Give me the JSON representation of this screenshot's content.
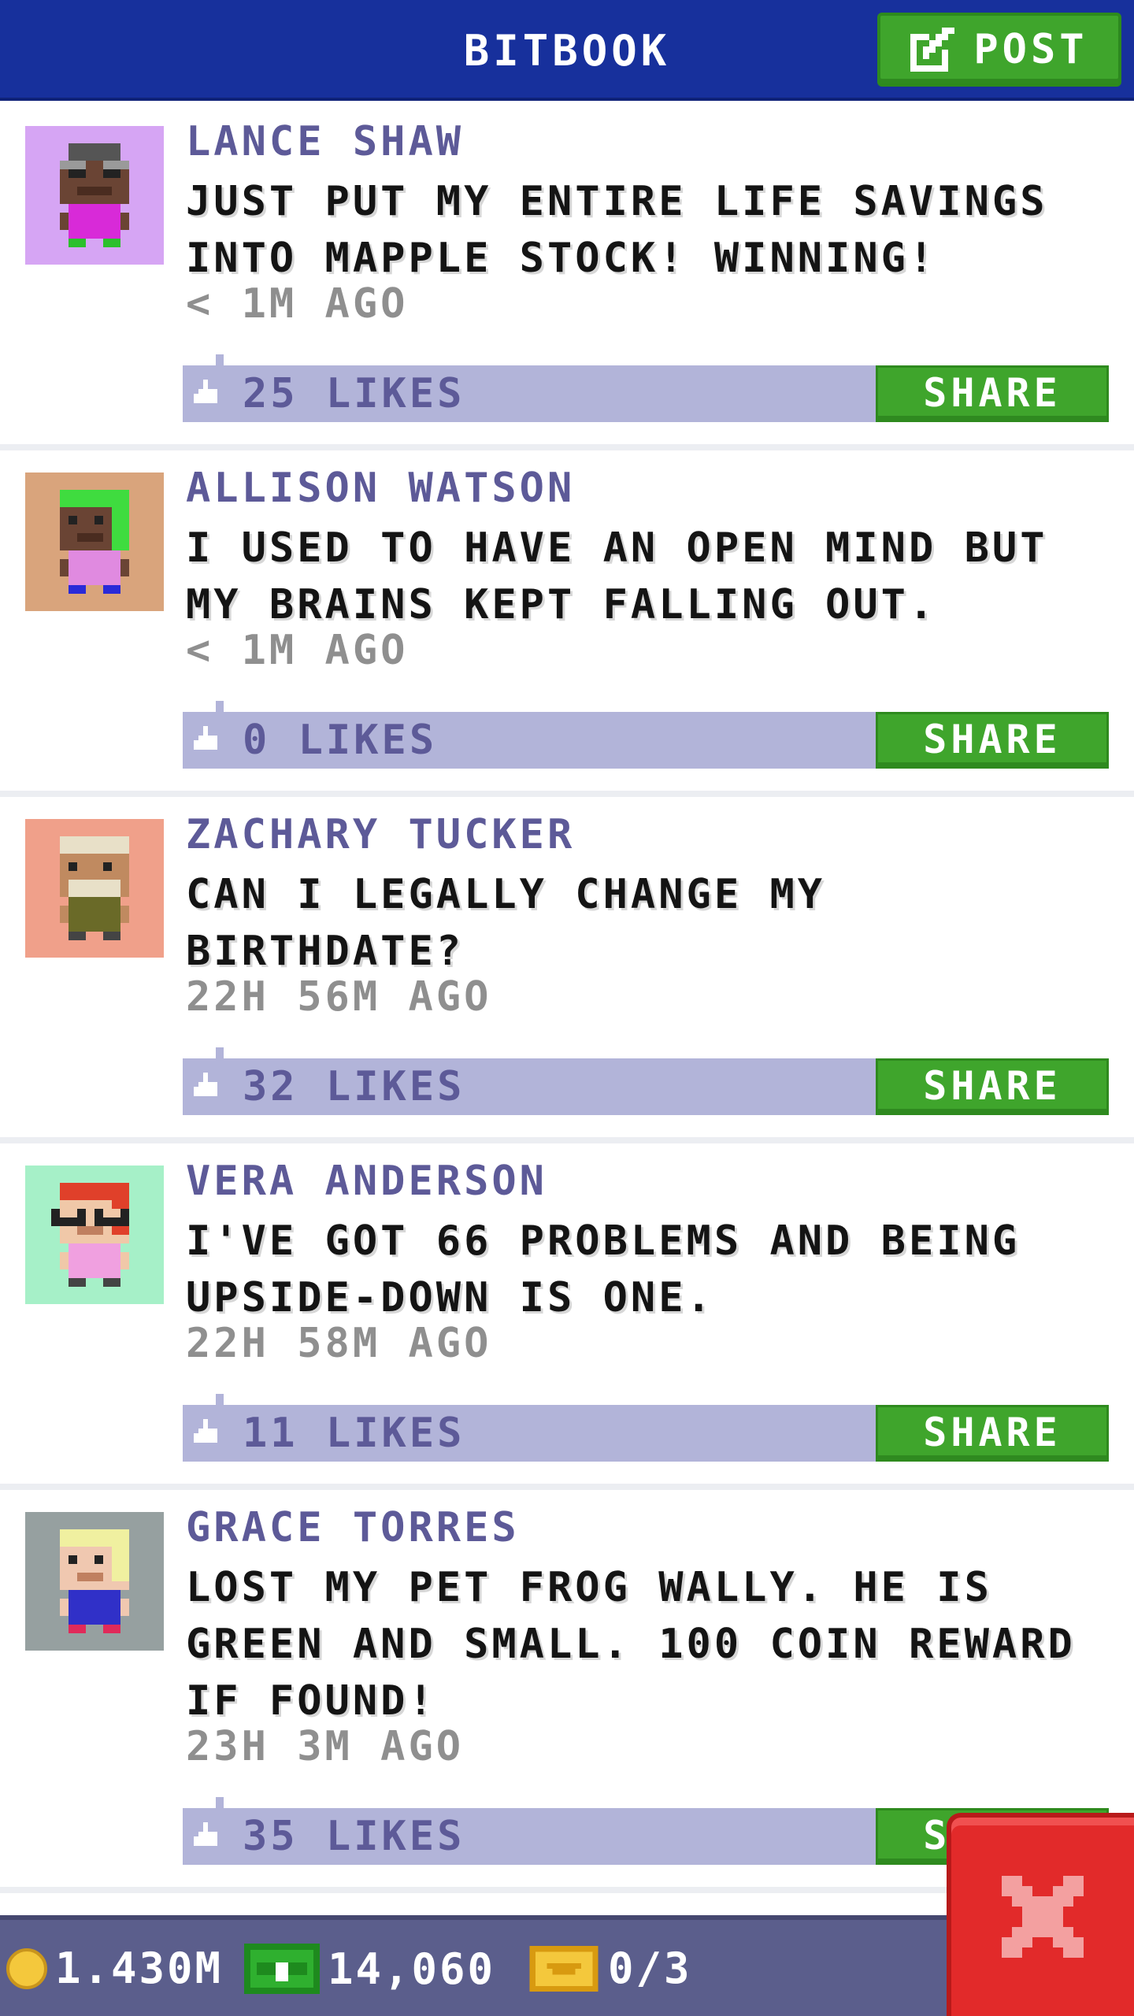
{
  "header": {
    "title": "BITBOOK",
    "post_label": "POST"
  },
  "posts": [
    {
      "name": "LANCE SHAW",
      "message": "JUST PUT MY ENTIRE LIFE SAVINGS INTO MAPPLE STOCK! WINNING!",
      "time": "< 1M AGO",
      "likes": "25 LIKES",
      "share_label": "SHARE",
      "avatar_bg": "#d6a5f4",
      "avatar_icon": "avatar-lance-shaw"
    },
    {
      "name": "ALLISON WATSON",
      "message": "I USED TO HAVE AN OPEN MIND BUT MY BRAINS KEPT FALLING OUT.",
      "time": "< 1M AGO",
      "likes": "0 LIKES",
      "share_label": "SHARE",
      "avatar_bg": "#d9a47c",
      "avatar_icon": "avatar-allison-watson"
    },
    {
      "name": "ZACHARY TUCKER",
      "message": "CAN I LEGALLY CHANGE MY BIRTHDATE?",
      "time": "22H 56M AGO",
      "likes": "32 LIKES",
      "share_label": "SHARE",
      "avatar_bg": "#f0a08a",
      "avatar_icon": "avatar-zachary-tucker"
    },
    {
      "name": "VERA ANDERSON",
      "message": "I'VE GOT 66 PROBLEMS AND BEING UPSIDE-DOWN IS ONE.",
      "time": "22H 58M AGO",
      "likes": "11 LIKES",
      "share_label": "SHARE",
      "avatar_bg": "#a6f0c8",
      "avatar_icon": "avatar-vera-anderson"
    },
    {
      "name": "GRACE TORRES",
      "message": "LOST MY PET FROG WALLY. HE IS GREEN AND SMALL. 100 COIN REWARD IF FOUND!",
      "time": "23H 3M AGO",
      "likes": "35 LIKES",
      "share_label": "SHARE",
      "avatar_bg": "#96a0a0",
      "avatar_icon": "avatar-grace-torres"
    }
  ],
  "bottom": {
    "coins": "1.430M",
    "bux": "14,060",
    "tickets": "0/3"
  },
  "colors": {
    "header": "#17309c",
    "accent_green": "#3fa52c",
    "likes_bar": "#b2b4d9",
    "close_red": "#e22a2a"
  }
}
